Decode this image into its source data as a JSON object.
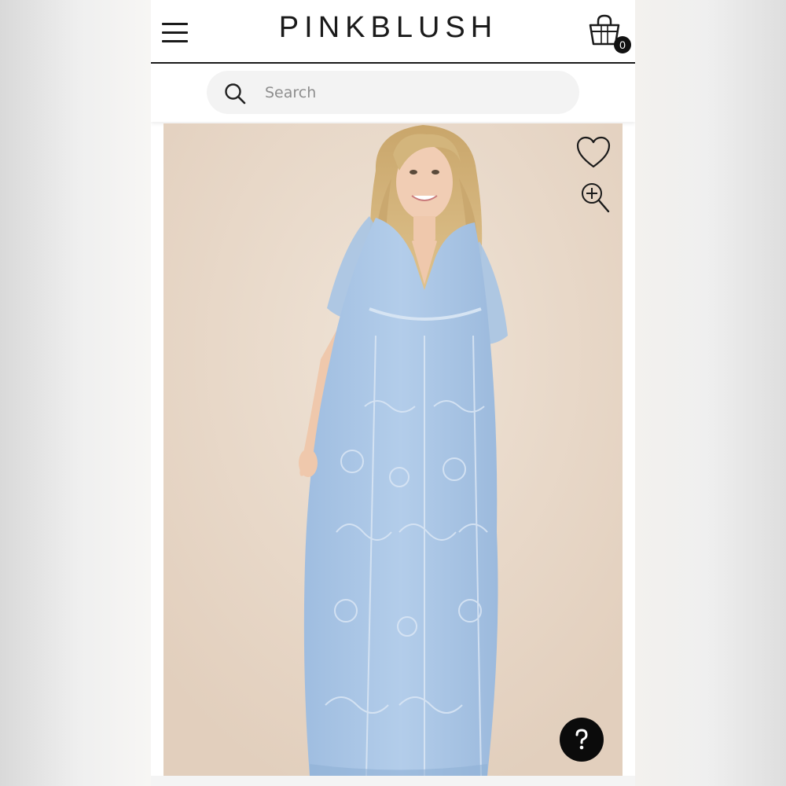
{
  "header": {
    "logo_text": "PINKBLUSH",
    "menu_icon": "hamburger-menu-icon",
    "cart_icon": "shopping-bag-icon",
    "cart_count": "0"
  },
  "search": {
    "placeholder": "Search",
    "value": "",
    "icon": "search-icon"
  },
  "product_image": {
    "wishlist_icon": "heart-outline-icon",
    "zoom_icon": "zoom-in-icon",
    "dress_color": "#a9c6e6"
  },
  "help": {
    "icon": "question-mark-icon"
  },
  "colors": {
    "brand_text": "#1a1a1a",
    "search_bg": "#f3f3f3",
    "image_bg": "#e8d8c9",
    "help_bg": "#0b0b0b"
  }
}
